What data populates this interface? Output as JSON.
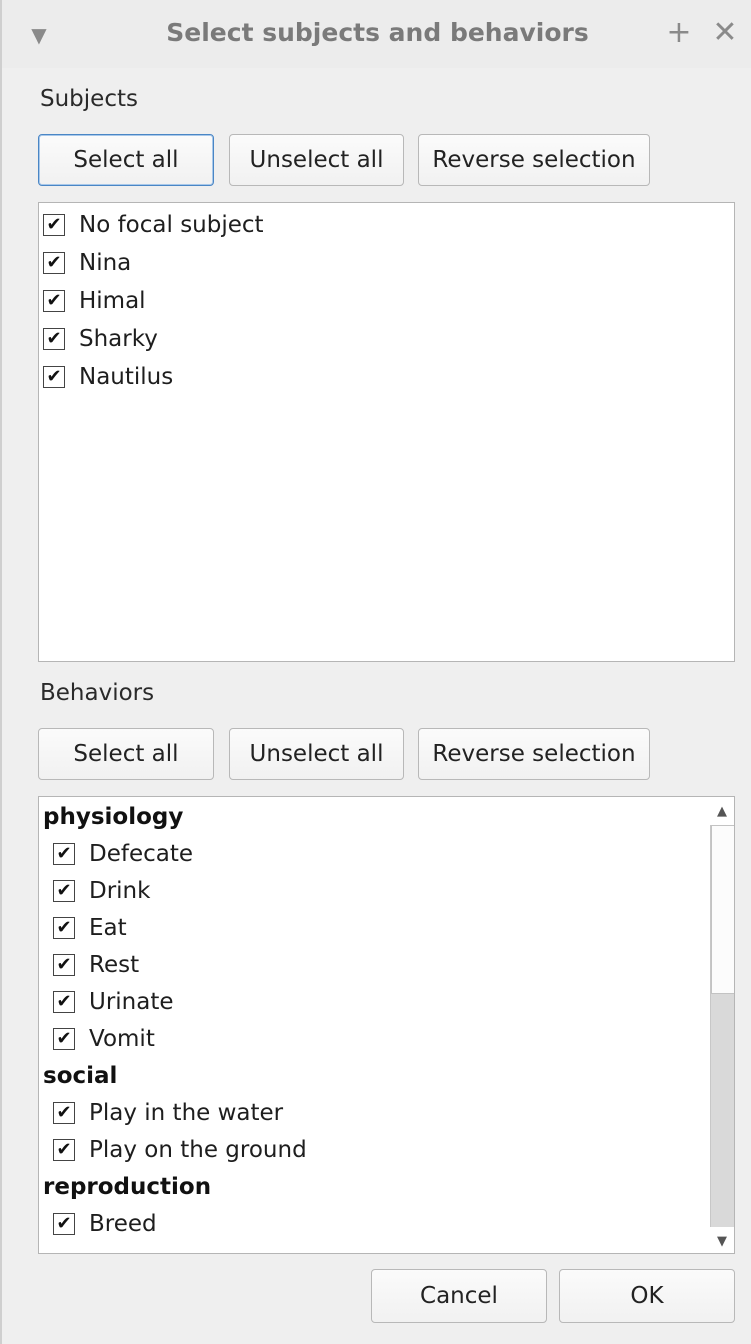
{
  "window": {
    "title": "Select subjects and behaviors",
    "menu_icon": "triangle-down-icon",
    "float_icon": "plus-icon",
    "close_icon": "close-icon"
  },
  "subjects": {
    "label": "Subjects",
    "buttons": {
      "select_all": "Select all",
      "unselect_all": "Unselect all",
      "reverse": "Reverse selection"
    },
    "items": [
      {
        "label": "No focal subject",
        "checked": true
      },
      {
        "label": "Nina",
        "checked": true
      },
      {
        "label": "Himal",
        "checked": true
      },
      {
        "label": "Sharky",
        "checked": true
      },
      {
        "label": "Nautilus",
        "checked": true
      }
    ]
  },
  "behaviors": {
    "label": "Behaviors",
    "buttons": {
      "select_all": "Select all",
      "unselect_all": "Unselect all",
      "reverse": "Reverse selection"
    },
    "groups": [
      {
        "name": "physiology",
        "items": [
          {
            "label": "Defecate",
            "checked": true
          },
          {
            "label": "Drink",
            "checked": true
          },
          {
            "label": "Eat",
            "checked": true
          },
          {
            "label": "Rest",
            "checked": true
          },
          {
            "label": "Urinate",
            "checked": true
          },
          {
            "label": "Vomit",
            "checked": true
          }
        ]
      },
      {
        "name": "social",
        "items": [
          {
            "label": "Play in the water",
            "checked": true
          },
          {
            "label": "Play on the ground",
            "checked": true
          }
        ]
      },
      {
        "name": "reproduction",
        "items": [
          {
            "label": "Breed",
            "checked": true
          }
        ]
      }
    ],
    "scrollbar": {
      "position_fraction": 0.0,
      "visible_fraction": 0.42
    }
  },
  "footer": {
    "cancel": "Cancel",
    "ok": "OK"
  },
  "check_glyph": "✔",
  "colors": {
    "focus_border": "#4a86c5",
    "list_bg": "#ffffff",
    "window_bg": "#efefef"
  }
}
